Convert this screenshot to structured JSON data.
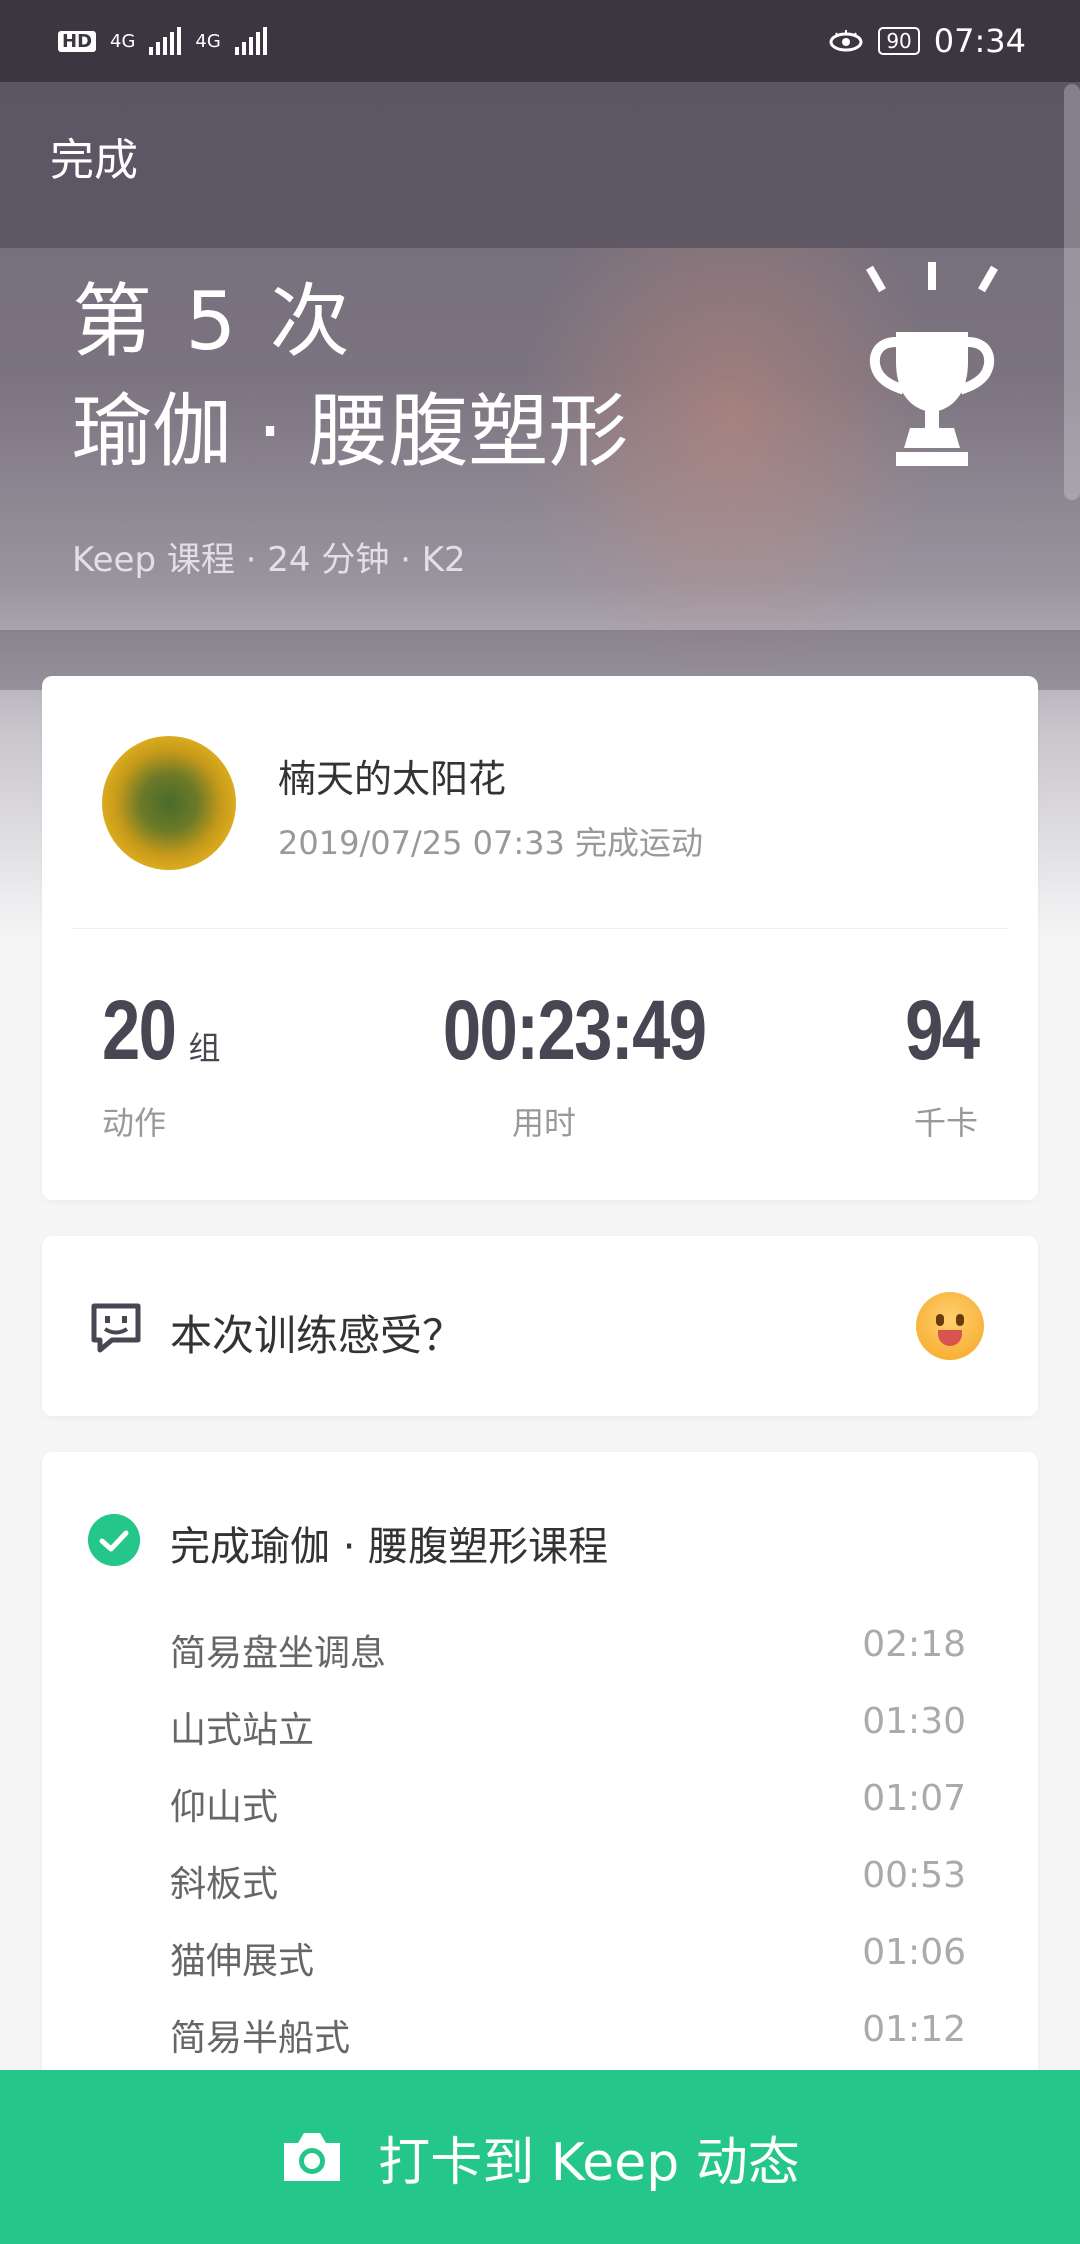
{
  "status_bar": {
    "left_labels": [
      "HD",
      "4G",
      "4G"
    ],
    "battery": "90",
    "time": "07:34"
  },
  "header": {
    "done_label": "完成"
  },
  "hero": {
    "count_label": "第 5 次",
    "course_title": "瑜伽 · 腰腹塑形",
    "meta": "Keep 课程 · 24 分钟 · K2",
    "trophy_icon": "trophy-icon"
  },
  "profile": {
    "name": "楠天的太阳花",
    "completed_at": "2019/07/25 07:33 完成运动"
  },
  "stats": {
    "actions_value": "20",
    "actions_unit": "组",
    "actions_label": "动作",
    "time_value": "00:23:49",
    "time_label": "用时",
    "calories_value": "94",
    "calories_label": "千卡"
  },
  "feel": {
    "prompt": "本次训练感受？",
    "icon": "feedback-icon",
    "emoji": "smile-emoji"
  },
  "course": {
    "title": "完成瑜伽 · 腰腹塑形课程",
    "exercises": [
      {
        "name": "简易盘坐调息",
        "time": "02:18"
      },
      {
        "name": "山式站立",
        "time": "01:30"
      },
      {
        "name": "仰山式",
        "time": "01:07"
      },
      {
        "name": "斜板式",
        "time": "00:53"
      },
      {
        "name": "猫伸展式",
        "time": "01:06"
      },
      {
        "name": "简易半船式",
        "time": "01:12"
      }
    ]
  },
  "checkin": {
    "label": "打卡到 Keep 动态",
    "icon": "camera-icon"
  },
  "colors": {
    "accent": "#24c789",
    "status_bar": "#3c3641",
    "stat_text": "#4a4552"
  }
}
